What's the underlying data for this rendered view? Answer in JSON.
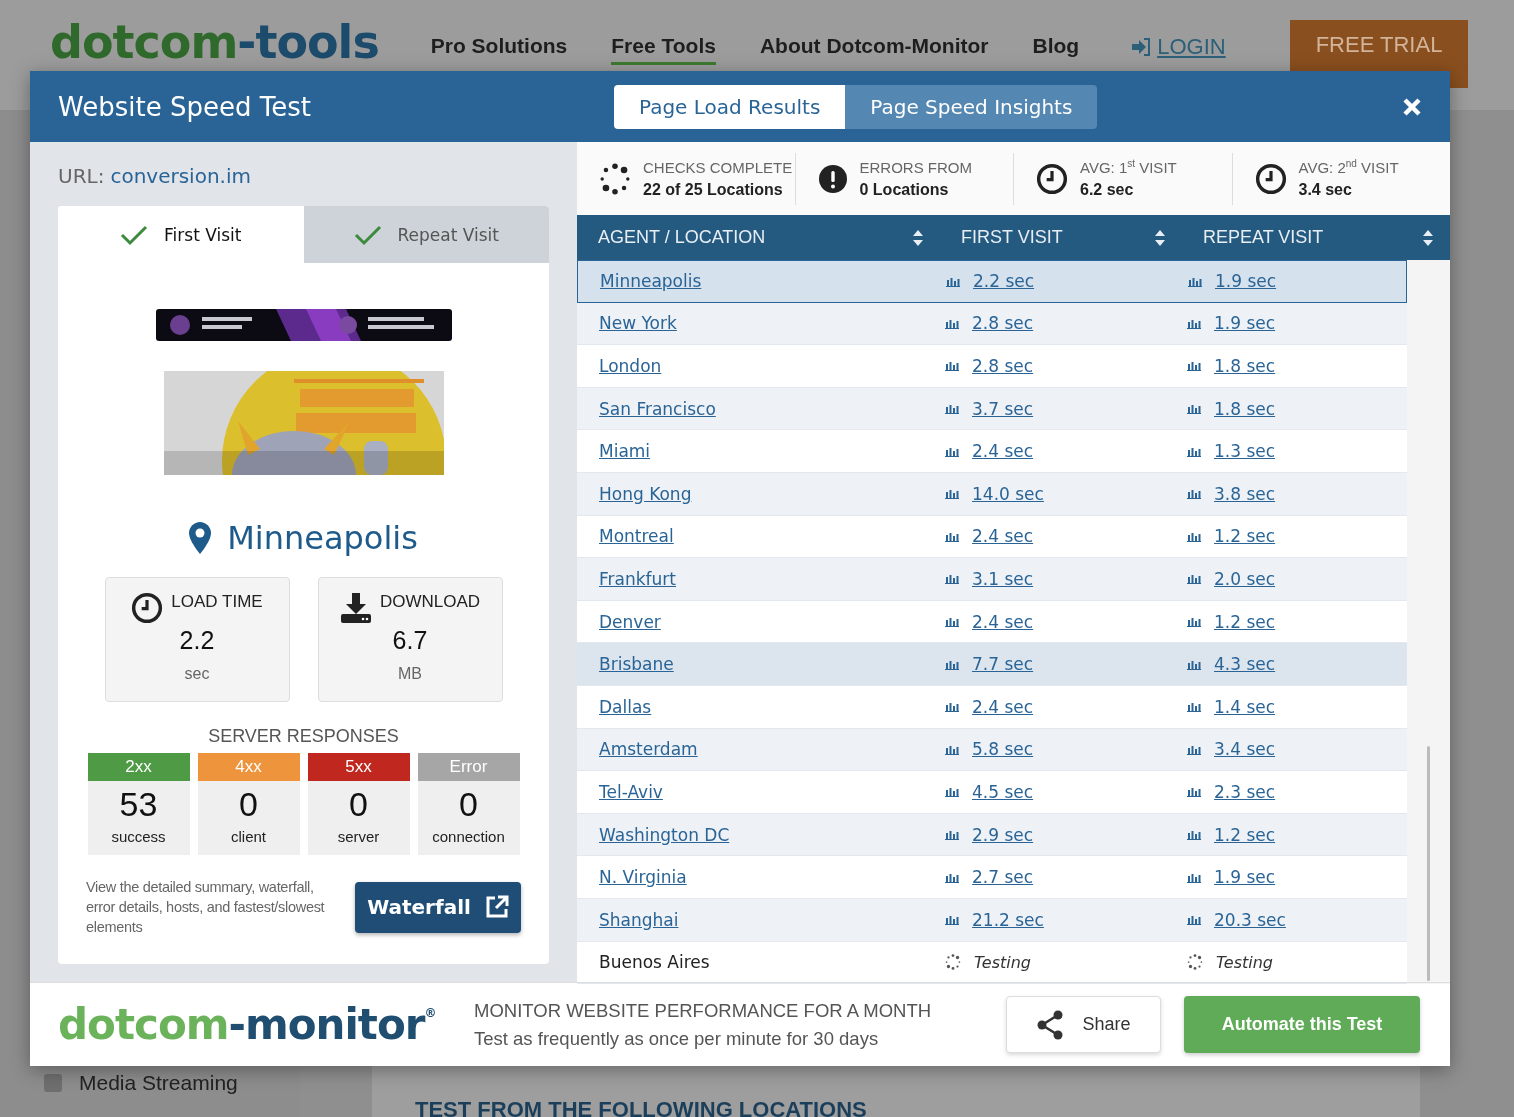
{
  "site_nav": {
    "logo": {
      "first": "dotcom",
      "second": "-tools"
    },
    "items": [
      {
        "label": "Pro Solutions",
        "selected": false
      },
      {
        "label": "Free Tools",
        "selected": true
      },
      {
        "label": "About Dotcom-Monitor",
        "selected": false
      },
      {
        "label": "Blog",
        "selected": false
      }
    ],
    "login": "LOGIN",
    "trial": "FREE TRIAL"
  },
  "background": {
    "sidebar_item": {
      "label": "Media Streaming",
      "checked": false
    },
    "heading": "TEST FROM THE FOLLOWING LOCATIONS"
  },
  "modal": {
    "title": "Website Speed Test",
    "tabs": [
      {
        "label": "Page Load Results",
        "selected": true
      },
      {
        "label": "Page Speed Insights",
        "selected": false
      }
    ],
    "url_label": "URL:",
    "url": "conversion.im",
    "visit_tabs": [
      {
        "label": "First Visit",
        "selected": true,
        "done": true
      },
      {
        "label": "Repeat Visit",
        "selected": false,
        "done": true
      }
    ],
    "location": "Minneapolis",
    "metrics": [
      {
        "kind": "time",
        "label": "LOAD TIME",
        "value": "2.2",
        "unit": "sec"
      },
      {
        "kind": "download",
        "label": "DOWNLOAD",
        "value": "6.7",
        "unit": "MB"
      }
    ],
    "server_responses": {
      "title": "SERVER RESPONSES",
      "items": [
        {
          "code": "2xx",
          "count": "53",
          "label": "success",
          "color": "#4f9a45"
        },
        {
          "code": "4xx",
          "count": "0",
          "label": "client",
          "color": "#ee943c"
        },
        {
          "code": "5xx",
          "count": "0",
          "label": "server",
          "color": "#c0271f"
        },
        {
          "code": "Error",
          "count": "0",
          "label": "connection",
          "color": "#a6a6a6"
        }
      ]
    },
    "waterfall_note": "View the detailed summary, waterfall, error details, hosts, and fastest/slowest elements",
    "waterfall_button": "Waterfall",
    "summary": [
      {
        "kind": "checks",
        "label": "CHECKS COMPLETE",
        "value": "22 of 25 Locations"
      },
      {
        "kind": "errors",
        "label": "ERRORS FROM",
        "value": "0 Locations"
      },
      {
        "kind": "avg",
        "label": "AVG: 1$^{st}$ VISIT",
        "value": "6.2 sec"
      },
      {
        "kind": "avg",
        "label": "AVG: 2$^{nd}$ VISIT",
        "value": "3.4 sec"
      }
    ],
    "table": {
      "columns": [
        "AGENT / LOCATION",
        "FIRST VISIT",
        "REPEAT VISIT"
      ],
      "rows": [
        {
          "kind": "result",
          "location": "Minneapolis",
          "first": "2.2 sec",
          "repeat": "1.9 sec",
          "selected": true,
          "highlighted": false
        },
        {
          "kind": "result",
          "location": "New York",
          "first": "2.8 sec",
          "repeat": "1.9 sec",
          "selected": false,
          "highlighted": false
        },
        {
          "kind": "result",
          "location": "London",
          "first": "2.8 sec",
          "repeat": "1.8 sec",
          "selected": false,
          "highlighted": false
        },
        {
          "kind": "result",
          "location": "San Francisco",
          "first": "3.7 sec",
          "repeat": "1.8 sec",
          "selected": false,
          "highlighted": false
        },
        {
          "kind": "result",
          "location": "Miami",
          "first": "2.4 sec",
          "repeat": "1.3 sec",
          "selected": false,
          "highlighted": false
        },
        {
          "kind": "result",
          "location": "Hong Kong",
          "first": "14.0 sec",
          "repeat": "3.8 sec",
          "selected": false,
          "highlighted": false
        },
        {
          "kind": "result",
          "location": "Montreal",
          "first": "2.4 sec",
          "repeat": "1.2 sec",
          "selected": false,
          "highlighted": false
        },
        {
          "kind": "result",
          "location": "Frankfurt",
          "first": "3.1 sec",
          "repeat": "2.0 sec",
          "selected": false,
          "highlighted": false
        },
        {
          "kind": "result",
          "location": "Denver",
          "first": "2.4 sec",
          "repeat": "1.2 sec",
          "selected": false,
          "highlighted": false
        },
        {
          "kind": "result",
          "location": "Brisbane",
          "first": "7.7 sec",
          "repeat": "4.3 sec",
          "selected": false,
          "highlighted": true
        },
        {
          "kind": "result",
          "location": "Dallas",
          "first": "2.4 sec",
          "repeat": "1.4 sec",
          "selected": false,
          "highlighted": false
        },
        {
          "kind": "result",
          "location": "Amsterdam",
          "first": "5.8 sec",
          "repeat": "3.4 sec",
          "selected": false,
          "highlighted": false
        },
        {
          "kind": "result",
          "location": "Tel-Aviv",
          "first": "4.5 sec",
          "repeat": "2.3 sec",
          "selected": false,
          "highlighted": false
        },
        {
          "kind": "result",
          "location": "Washington DC",
          "first": "2.9 sec",
          "repeat": "1.2 sec",
          "selected": false,
          "highlighted": false
        },
        {
          "kind": "result",
          "location": "N. Virginia",
          "first": "2.7 sec",
          "repeat": "1.9 sec",
          "selected": false,
          "highlighted": false
        },
        {
          "kind": "result",
          "location": "Shanghai",
          "first": "21.2 sec",
          "repeat": "20.3 sec",
          "selected": false,
          "highlighted": false
        },
        {
          "kind": "testing",
          "location": "Buenos Aires",
          "first": "Testing",
          "repeat": "Testing",
          "selected": false,
          "highlighted": false
        }
      ]
    },
    "footer": {
      "logo": {
        "first": "dotcom",
        "second": "-monitor",
        "mark": "®"
      },
      "headline": "MONITOR WEBSITE PERFORMANCE FOR A MONTH",
      "subline": "Test as frequently as once per minute for 30 days",
      "share": "Share",
      "automate": "Automate this Test"
    }
  }
}
